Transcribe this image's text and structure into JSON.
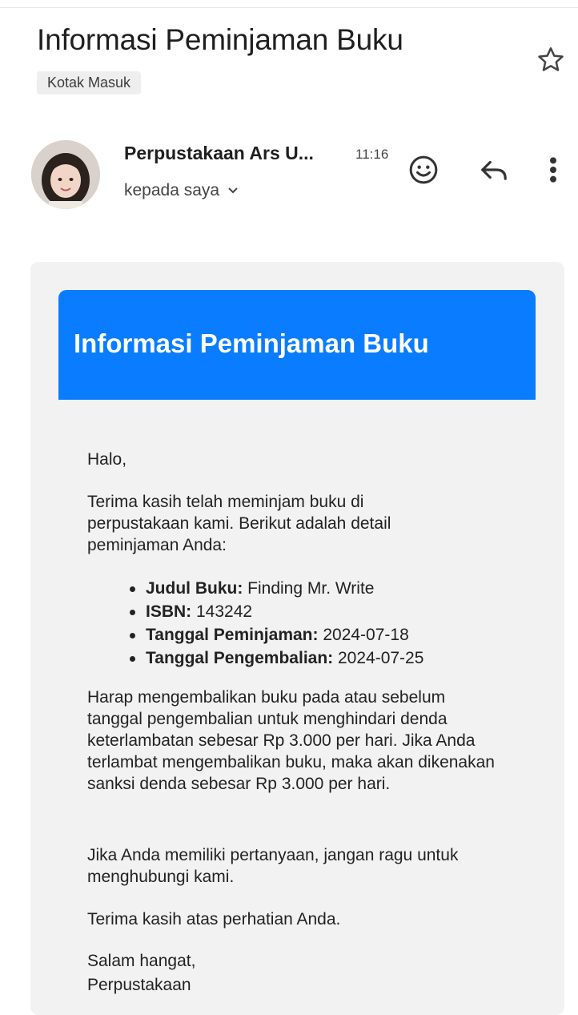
{
  "header": {
    "subject": "Informasi Peminjaman Buku",
    "label": "Kotak Masuk",
    "sender_name": "Perpustakaan Ars U...",
    "time": "11:16",
    "recipient_text": "kepada saya"
  },
  "icons": {
    "star": "star-outline-icon",
    "emoji": "add-reaction-icon",
    "reply": "reply-icon",
    "more": "more-vertical-icon"
  },
  "email": {
    "banner_title": "Informasi Peminjaman Buku",
    "banner_color": "#0a7cff",
    "greeting": "Halo,",
    "intro": "Terima kasih telah meminjam buku di perpustakaan kami. Berikut adalah detail peminjaman Anda:",
    "details": [
      {
        "label": "Judul Buku:",
        "value": " Finding Mr. Write"
      },
      {
        "label": "ISBN:",
        "value": " 143242"
      },
      {
        "label": "Tanggal Peminjaman:",
        "value": " 2024-07-18"
      },
      {
        "label": "Tanggal Pengembalian:",
        "value": " 2024-07-25"
      }
    ],
    "reminder": "Harap mengembalikan buku pada atau sebelum tanggal pengembalian untuk menghindari denda keterlambatan sebesar Rp 3.000 per hari. Jika Anda terlambat mengembalikan buku, maka akan dikenakan sanksi denda sebesar Rp 3.000 per hari.",
    "questions": "Jika Anda memiliki pertanyaan, jangan ragu untuk menghubungi kami.",
    "thanks": "Terima kasih atas perhatian Anda.",
    "closing": "Salam hangat,",
    "signature": "Perpustakaan"
  }
}
